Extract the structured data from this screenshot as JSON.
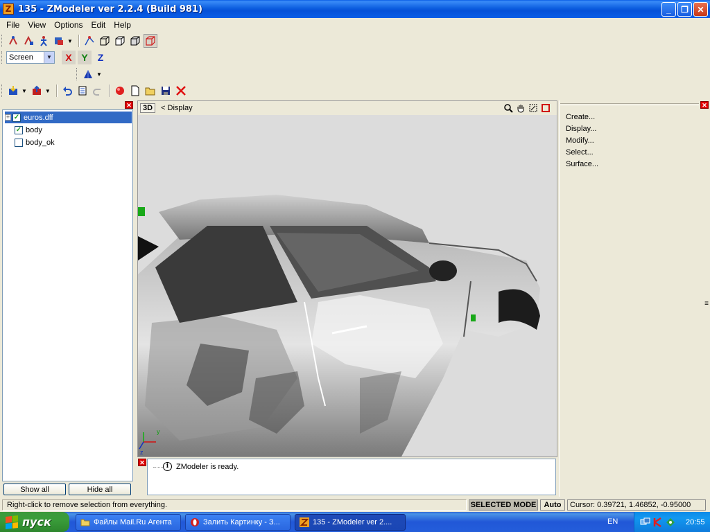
{
  "window": {
    "title": "135 - ZModeler ver 2.2.4 (Build 981)",
    "icon_letter": "Z",
    "controls": {
      "minimize": "_",
      "maximize": "❐",
      "close": "✕"
    }
  },
  "menu": [
    "File",
    "View",
    "Options",
    "Edit",
    "Help"
  ],
  "toolbar": {
    "view_select": "Screen",
    "axes": {
      "x": "X",
      "y": "Y",
      "z": "Z"
    }
  },
  "left_panel": {
    "tree": [
      {
        "label": "euros.dff",
        "checked": true,
        "expandable": true,
        "selected": true
      },
      {
        "label": "body",
        "checked": true,
        "expandable": false,
        "selected": false
      },
      {
        "label": "body_ok",
        "checked": false,
        "expandable": false,
        "selected": false
      }
    ],
    "show_all": "Show all",
    "hide_all": "Hide all"
  },
  "viewport": {
    "mode": "3D",
    "label": "<  Display",
    "axis_labels": {
      "y": "y",
      "z": "z"
    }
  },
  "messages": {
    "line1": "ZModeler is ready."
  },
  "right_panel": {
    "commands": [
      "Create...",
      "Display...",
      "Modify...",
      "Select...",
      "Surface..."
    ]
  },
  "status": {
    "hint": "Right-click to remove selection from everything.",
    "mode": "SELECTED MODE",
    "auto": "Auto",
    "cursor": "Cursor: 0.39721, 1.46852, -0.95000"
  },
  "taskbar": {
    "start": "пуск",
    "tasks": [
      "Файлы Mail.Ru Агента",
      "Залить Картинку - З...",
      "135 - ZModeler ver 2...."
    ],
    "lang": "EN",
    "clock": "20:55"
  },
  "colors": {
    "title_blue": "#0a5ee6",
    "selection": "#316ac5",
    "close_red": "#e00000",
    "start_green": "#3a9c3a"
  }
}
